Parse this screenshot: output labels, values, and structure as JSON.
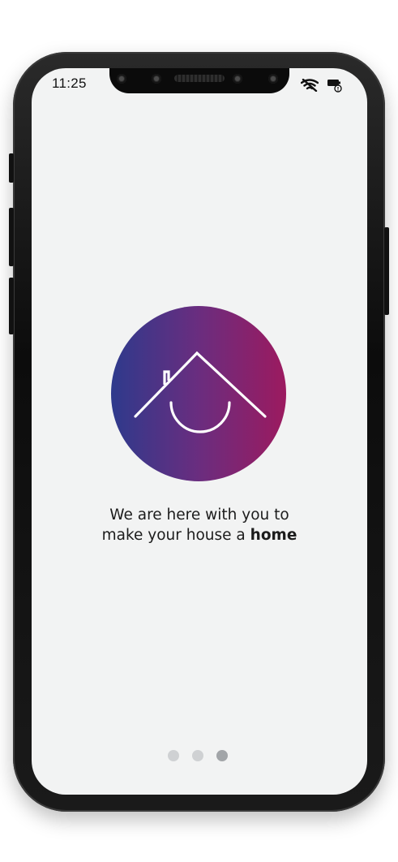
{
  "status_bar": {
    "time": "11:25",
    "icons": [
      "wifi-off-icon",
      "battery-alert-icon"
    ]
  },
  "onboarding": {
    "logo_icon": "house-smile-icon",
    "tagline_line1": "We are here with you to",
    "tagline_line2_prefix": "make your house a ",
    "tagline_emphasis": "home",
    "page_count": 3,
    "active_page": 3
  },
  "colors": {
    "screen_bg": "#f2f3f3",
    "logo_gradient_start": "#2e3a8c",
    "logo_gradient_mid": "#6a2d7f",
    "logo_gradient_end": "#9c1a5f",
    "dot_inactive": "#cfd1d3",
    "dot_active": "#a2a5a8"
  }
}
